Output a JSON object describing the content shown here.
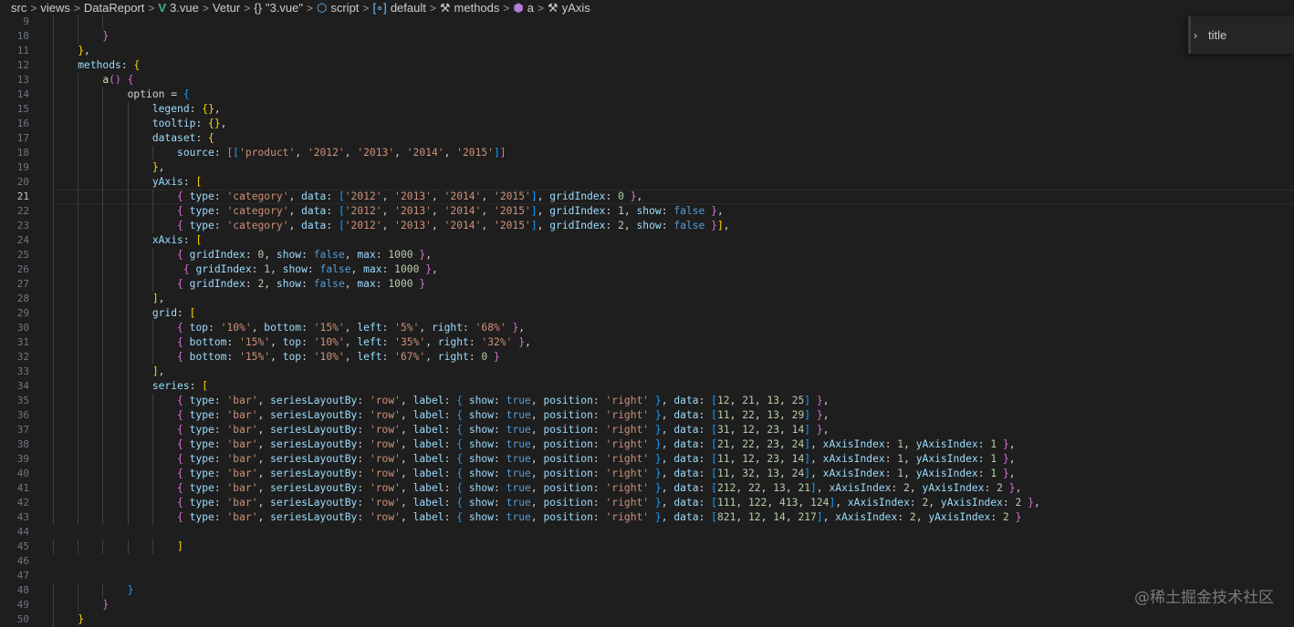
{
  "breadcrumb": [
    {
      "label": "src",
      "icon": ""
    },
    {
      "label": "views",
      "icon": ""
    },
    {
      "label": "DataReport",
      "icon": ""
    },
    {
      "label": "3.vue",
      "icon": "vue-icon"
    },
    {
      "label": "Vetur",
      "icon": ""
    },
    {
      "label": "\"3.vue\"",
      "icon": "braces-icon"
    },
    {
      "label": "script",
      "icon": "module-icon"
    },
    {
      "label": "default",
      "icon": "variable-icon"
    },
    {
      "label": "methods",
      "icon": "wrench-icon"
    },
    {
      "label": "a",
      "icon": "method-icon"
    },
    {
      "label": "yAxis",
      "icon": "wrench-icon"
    }
  ],
  "outline": {
    "label": "title"
  },
  "watermark": "@稀土掘金技术社区",
  "colors": {
    "background": "#1e1e1e",
    "keyword_property": "#9cdcfe",
    "string": "#ce9178",
    "number": "#b5cea8",
    "boolean": "#569cd6",
    "function": "#dcdcaa",
    "bracket_gold": "#ffd700",
    "bracket_purple": "#da70d6",
    "bracket_blue": "#179fff"
  },
  "current_line": 21,
  "lines": [
    {
      "n": 9,
      "t": "            "
    },
    {
      "n": 10,
      "t": "        }"
    },
    {
      "n": 11,
      "t": "    },"
    },
    {
      "n": 12,
      "t": "    methods: {"
    },
    {
      "n": 13,
      "t": "        a() {"
    },
    {
      "n": 14,
      "t": "            option = {"
    },
    {
      "n": 15,
      "t": "                legend: {},"
    },
    {
      "n": 16,
      "t": "                tooltip: {},"
    },
    {
      "n": 17,
      "t": "                dataset: {"
    },
    {
      "n": 18,
      "t": "                    source: [['product', '2012', '2013', '2014', '2015']]"
    },
    {
      "n": 19,
      "t": "                },"
    },
    {
      "n": 20,
      "t": "                yAxis: ["
    },
    {
      "n": 21,
      "t": "                    { type: 'category', data: ['2012', '2013', '2014', '2015'], gridIndex: 0 },"
    },
    {
      "n": 22,
      "t": "                    { type: 'category', data: ['2012', '2013', '2014', '2015'], gridIndex: 1, show: false },"
    },
    {
      "n": 23,
      "t": "                    { type: 'category', data: ['2012', '2013', '2014', '2015'], gridIndex: 2, show: false }],"
    },
    {
      "n": 24,
      "t": "                xAxis: ["
    },
    {
      "n": 25,
      "t": "                    { gridIndex: 0, show: false, max: 1000 },"
    },
    {
      "n": 26,
      "t": "                     { gridIndex: 1, show: false, max: 1000 },"
    },
    {
      "n": 27,
      "t": "                    { gridIndex: 2, show: false, max: 1000 }"
    },
    {
      "n": 28,
      "t": "                ],"
    },
    {
      "n": 29,
      "t": "                grid: ["
    },
    {
      "n": 30,
      "t": "                    { top: '10%', bottom: '15%', left: '5%', right: '68%' },"
    },
    {
      "n": 31,
      "t": "                    { bottom: '15%', top: '10%', left: '35%', right: '32%' },"
    },
    {
      "n": 32,
      "t": "                    { bottom: '15%', top: '10%', left: '67%', right: 0 }"
    },
    {
      "n": 33,
      "t": "                ],"
    },
    {
      "n": 34,
      "t": "                series: ["
    },
    {
      "n": 35,
      "t": "                    { type: 'bar', seriesLayoutBy: 'row', label: { show: true, position: 'right' }, data: [12, 21, 13, 25] },"
    },
    {
      "n": 36,
      "t": "                    { type: 'bar', seriesLayoutBy: 'row', label: { show: true, position: 'right' }, data: [11, 22, 13, 29] },"
    },
    {
      "n": 37,
      "t": "                    { type: 'bar', seriesLayoutBy: 'row', label: { show: true, position: 'right' }, data: [31, 12, 23, 14] },"
    },
    {
      "n": 38,
      "t": "                    { type: 'bar', seriesLayoutBy: 'row', label: { show: true, position: 'right' }, data: [21, 22, 23, 24], xAxisIndex: 1, yAxisIndex: 1 },"
    },
    {
      "n": 39,
      "t": "                    { type: 'bar', seriesLayoutBy: 'row', label: { show: true, position: 'right' }, data: [11, 12, 23, 14], xAxisIndex: 1, yAxisIndex: 1 },"
    },
    {
      "n": 40,
      "t": "                    { type: 'bar', seriesLayoutBy: 'row', label: { show: true, position: 'right' }, data: [11, 32, 13, 24], xAxisIndex: 1, yAxisIndex: 1 },"
    },
    {
      "n": 41,
      "t": "                    { type: 'bar', seriesLayoutBy: 'row', label: { show: true, position: 'right' }, data: [212, 22, 13, 21], xAxisIndex: 2, yAxisIndex: 2 },"
    },
    {
      "n": 42,
      "t": "                    { type: 'bar', seriesLayoutBy: 'row', label: { show: true, position: 'right' }, data: [111, 122, 413, 124], xAxisIndex: 2, yAxisIndex: 2 },"
    },
    {
      "n": 43,
      "t": "                    { type: 'bar', seriesLayoutBy: 'row', label: { show: true, position: 'right' }, data: [821, 12, 14, 217], xAxisIndex: 2, yAxisIndex: 2 }"
    },
    {
      "n": 44,
      "t": ""
    },
    {
      "n": 45,
      "t": "                    ]"
    },
    {
      "n": 46,
      "t": ""
    },
    {
      "n": 47,
      "t": ""
    },
    {
      "n": 48,
      "t": "            }"
    },
    {
      "n": 49,
      "t": "        }"
    },
    {
      "n": 50,
      "t": "    }"
    }
  ]
}
